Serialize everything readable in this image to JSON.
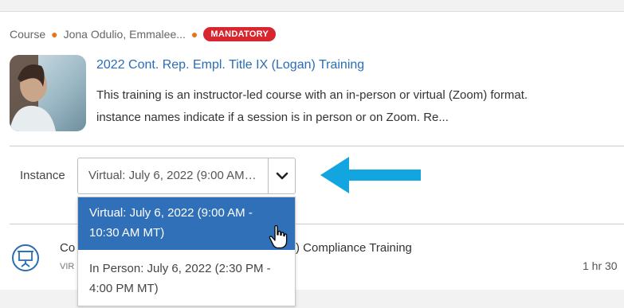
{
  "course": {
    "type_label": "Course",
    "authors": "Jona Odulio, Emmalee...",
    "badge": "MANDATORY",
    "title": "2022 Cont. Rep. Empl. Title IX (Logan) Training",
    "description_line1": "This training is an instructor-led course with an in-person or virtual (Zoom) format.",
    "description_line2": "instance names indicate if a session is in person or on Zoom.    Re...",
    "thumbnail_icon": "person-photo"
  },
  "instance": {
    "label": "Instance",
    "selected_value": "Virtual: July 6, 2022 (9:00 AM - 10:30 AM MT)",
    "chevron_icon": "chevron-down-icon",
    "options": [
      {
        "label": "Virtual: July 6, 2022 (9:00 AM - 10:30 AM MT)",
        "highlighted": true
      },
      {
        "label": "In Person: July 6, 2022 (2:30 PM - 4:00 PM MT)",
        "highlighted": false
      }
    ]
  },
  "next_item": {
    "icon": "presentation-board-icon",
    "title_start": "Co",
    "title_end": ") Compliance Training",
    "subtitle": "VIR",
    "duration": "1 hr 30"
  },
  "colors": {
    "link": "#2a6db7",
    "badge": "#d8262e",
    "dot": "#e8731c",
    "highlight": "#2f70b8",
    "arrow": "#12a5e0"
  }
}
